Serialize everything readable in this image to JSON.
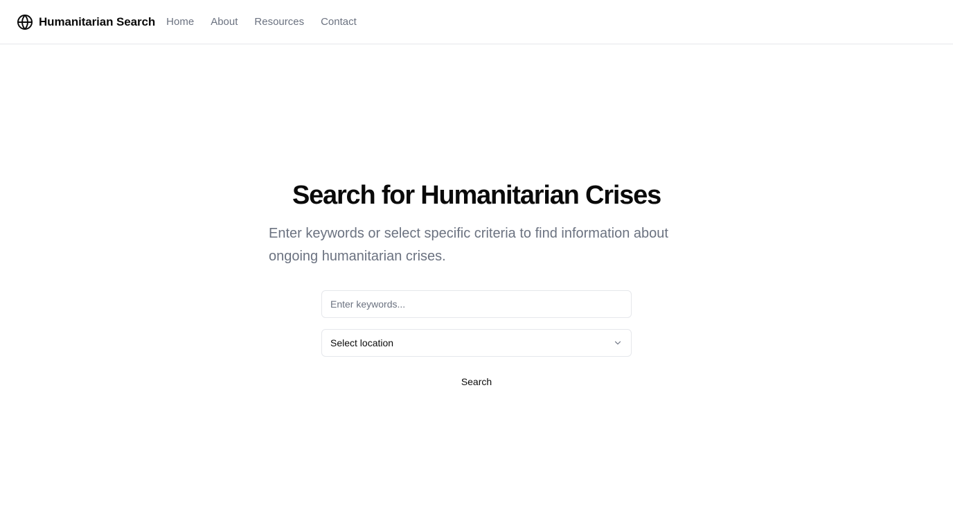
{
  "header": {
    "brand_name": "Humanitarian Search",
    "brand_icon": "globe-icon",
    "nav": [
      {
        "label": "Home"
      },
      {
        "label": "About"
      },
      {
        "label": "Resources"
      },
      {
        "label": "Contact"
      }
    ]
  },
  "hero": {
    "title": "Search for Humanitarian Crises",
    "subtitle": "Enter keywords or select specific criteria to find information about ongoing humanitarian crises."
  },
  "search": {
    "keyword_placeholder": "Enter keywords...",
    "keyword_value": "",
    "location_selected": "Select location",
    "location_icon": "chevron-down-icon",
    "button_label": "Search"
  },
  "colors": {
    "text_primary": "#0a0a0a",
    "text_muted": "#6b7280",
    "border": "#e5e7eb",
    "background": "#ffffff"
  }
}
